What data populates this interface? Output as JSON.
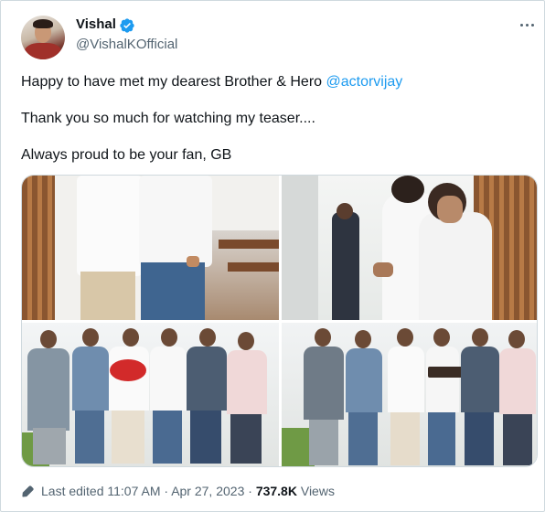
{
  "author": {
    "name": "Vishal",
    "handle": "@VishalKOfficial",
    "verified": true,
    "verified_color": "#1d9bf0"
  },
  "tweet": {
    "line1_text": "Happy to have met my dearest Brother & Hero ",
    "line1_mention": "@actorvijay",
    "line2": "Thank you so much for watching my teaser....",
    "line3": "Always proud to be your fan, GB"
  },
  "footer": {
    "edited": "Last edited 11:07 AM",
    "separator1": "·",
    "date": "Apr 27, 2023",
    "separator2": "·",
    "views_count": "737.8K",
    "views_label": "Views"
  },
  "icons": {
    "more": "more-horizontal-icon",
    "edit": "pencil-icon",
    "verified": "verified-badge-icon"
  },
  "colors": {
    "text": "#0f1419",
    "secondary": "#536471",
    "link": "#1d9bf0",
    "border": "#cfd9de"
  }
}
